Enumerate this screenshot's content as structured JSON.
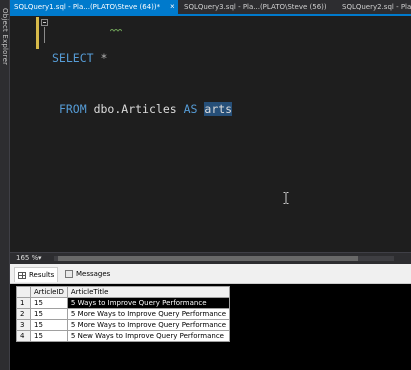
{
  "sidebar": {
    "object_explorer_label": "Object Explorer"
  },
  "tabs": [
    {
      "label": "SQLQuery1.sql - Pla...(PLATO\\Steve (64))*",
      "close": "×"
    },
    {
      "label": "SQLQuery3.sql - Pla...(PLATO\\Steve (56))"
    },
    {
      "label": "SQLQuery2.sql - Pla"
    }
  ],
  "editor": {
    "line1": {
      "kw": "SELECT",
      "op": "*"
    },
    "line2": {
      "kw1": "FROM",
      "obj": "dbo.Articles",
      "kw2": "AS",
      "alias": "arts"
    }
  },
  "zoom": {
    "value": "165 %",
    "dropdown": "▾"
  },
  "results": {
    "tabs": {
      "results": "Results",
      "messages": "Messages"
    },
    "columns": [
      "ArticleID",
      "ArticleTitle"
    ],
    "rows": [
      {
        "num": "1",
        "id": "15",
        "title": "5 Ways to Improve Query Performance"
      },
      {
        "num": "2",
        "id": "15",
        "title": "5 More Ways to Improve Query Performance"
      },
      {
        "num": "3",
        "id": "15",
        "title": "5 More Ways to Improve Query Performance"
      },
      {
        "num": "4",
        "id": "15",
        "title": "5 New Ways to Improve Query Performance"
      }
    ]
  },
  "colors": {
    "accent": "#007acc",
    "keyword": "#569cd6",
    "selection": "#264f78",
    "change_bar": "#d7ba4a"
  },
  "icons": {
    "close": "close-icon",
    "results": "grid-icon",
    "messages": "messages-icon",
    "cursor": "ibeam-cursor-icon"
  }
}
